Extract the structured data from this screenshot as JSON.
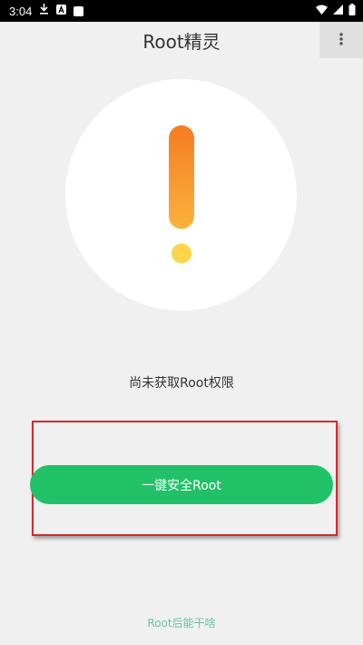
{
  "status_bar": {
    "time": "3:04",
    "icons_left": [
      "download-icon",
      "a-icon",
      "square-icon"
    ],
    "icons_right": [
      "wifi-icon",
      "signal-icon",
      "battery-icon"
    ]
  },
  "header": {
    "title": "Root精灵",
    "menu_icon": "more-vert-icon"
  },
  "main": {
    "warning_icon": "exclamation-icon",
    "status_text": "尚未获取Root权限",
    "action_button": "一键安全Root",
    "footer_link": "Root后能干啥"
  },
  "colors": {
    "accent_green": "#21c168",
    "highlight_red": "#d62a2a",
    "warning_orange": "#f57c22",
    "warning_yellow": "#fdd54a",
    "link_green": "#6bc4a0"
  }
}
